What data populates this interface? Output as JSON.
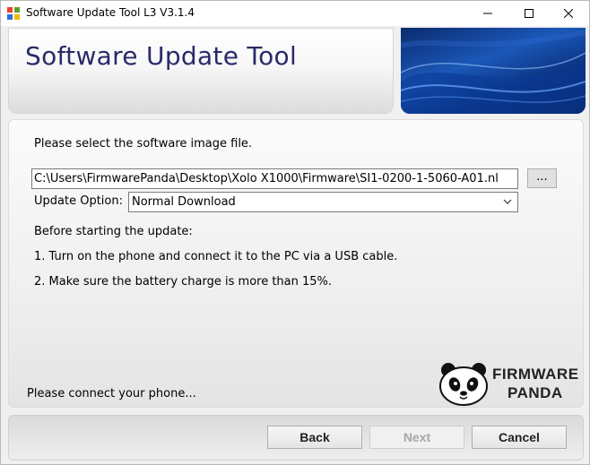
{
  "window": {
    "title": "Software Update Tool L3 V3.1.4",
    "minimize_icon": "minimize-icon",
    "maximize_icon": "maximize-icon",
    "close_icon": "close-icon"
  },
  "banner": {
    "title": "Software Update Tool"
  },
  "main": {
    "prompt": "Please select the software image file.",
    "path_value": "C:\\Users\\FirmwarePanda\\Desktop\\Xolo X1000\\Firmware\\SI1-0200-1-5060-A01.nl",
    "browse_label": "...",
    "update_option_label": "Update Option:",
    "update_option_value": "Normal Download",
    "before_heading": "Before starting the update:",
    "step1": "1. Turn on the phone and connect it to the PC via a USB cable.",
    "step2": "2. Make sure the battery charge is more than 15%.",
    "status": "Please connect your phone..."
  },
  "logo": {
    "line1": "FIRMWARE",
    "line2": "PANDA"
  },
  "buttons": {
    "back": "Back",
    "next": "Next",
    "cancel": "Cancel"
  },
  "colors": {
    "banner_title": "#2a2a6a",
    "banner_art": "#1b58b8"
  }
}
